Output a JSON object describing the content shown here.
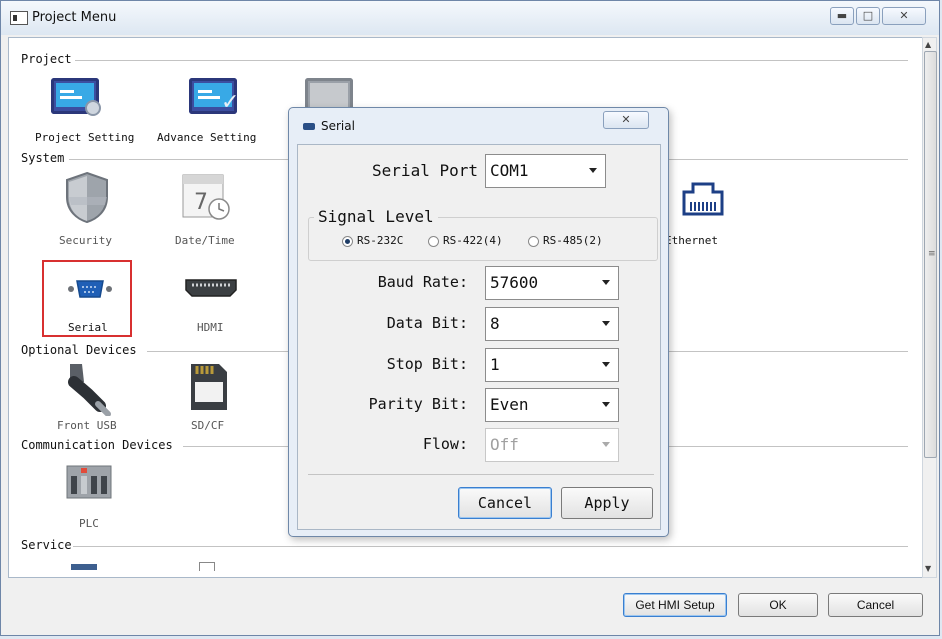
{
  "window": {
    "title": "Project Menu",
    "icons": [
      "minimize-icon",
      "maximize-icon",
      "close-icon"
    ]
  },
  "sections": {
    "project": "Project",
    "system": "System",
    "optional": "Optional Devices",
    "communication": "Communication Devices",
    "service": "Service"
  },
  "items": {
    "project_setting": "Project Setting",
    "advance_setting": "Advance Setting",
    "security": "Security",
    "datetime": "Date/Time",
    "ethernet": "Ethernet",
    "serial": "Serial",
    "hdmi": "HDMI",
    "front_usb": "Front USB",
    "sdcf": "SD/CF",
    "plc": "PLC"
  },
  "footer": {
    "get_hmi_setup": "Get HMI Setup",
    "ok": "OK",
    "cancel": "Cancel"
  },
  "dialog": {
    "title": "Serial",
    "close_glyph": "✕",
    "serial_port": {
      "label": "Serial Port",
      "value": "COM1"
    },
    "signal_level": {
      "label": "Signal Level",
      "options": [
        "RS-232C",
        "RS-422(4)",
        "RS-485(2)"
      ],
      "selected": "RS-232C"
    },
    "baud_rate": {
      "label": "Baud Rate:",
      "value": "57600"
    },
    "data_bit": {
      "label": "Data Bit:",
      "value": "8"
    },
    "stop_bit": {
      "label": "Stop Bit:",
      "value": "1"
    },
    "parity_bit": {
      "label": "Parity Bit:",
      "value": "Even"
    },
    "flow": {
      "label": "Flow:",
      "value": "Off",
      "enabled": false
    },
    "cancel": "Cancel",
    "apply": "Apply"
  },
  "colors": {
    "highlight": "#d83030",
    "monitor": "#3c4ea0",
    "screen": "#38a9e6"
  }
}
